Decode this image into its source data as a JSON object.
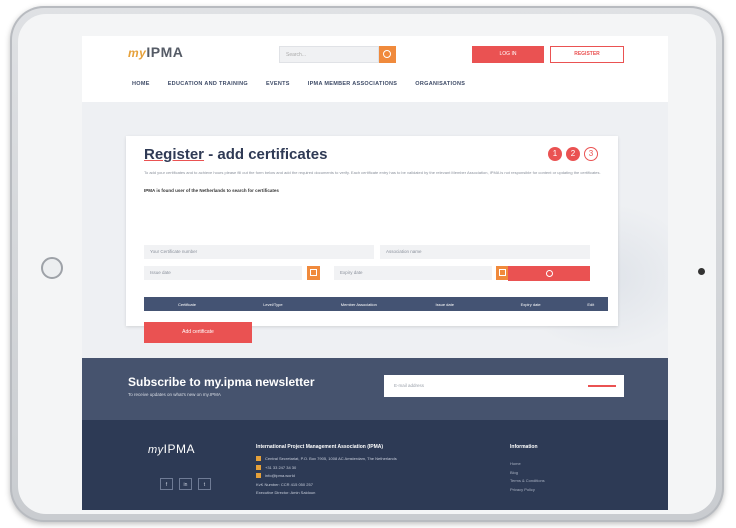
{
  "header": {
    "logo_prefix": "my",
    "logo_main": "IPMA",
    "search_placeholder": "Search...",
    "login_label": "LOG IN",
    "register_label": "REGISTER",
    "nav": [
      "HOME",
      "EDUCATION AND TRAINING",
      "EVENTS",
      "IPMA MEMBER ASSOCIATIONS",
      "ORGANISATIONS"
    ]
  },
  "card": {
    "title_part1": "Register",
    "title_part2": " - add certificates",
    "step_icons": [
      "1",
      "2",
      "3"
    ],
    "description": "To add your certificates and to achieve hours please fill out the form below and add the required documents to verify. Each certificate entry has to be validated by the relevant Member Association, IPMA is not responsible for content or updating the certificates.",
    "description_strong": "IPMA is found user of the Netherlands to search for certificates",
    "fields": {
      "cert_number": "Your Certificate number",
      "member_association": "Association name",
      "issue_date": "Issue date",
      "expiry_date": "Expiry date"
    },
    "table_headers": [
      "Certificate",
      "Level/Type",
      "Member Association",
      "Issue date",
      "Expiry date",
      "Edit"
    ],
    "add_button": "Add certificate"
  },
  "newsletter": {
    "title": "Subscribe to my.ipma newsletter",
    "subtitle": "To receive updates on what's new on my.IPMA",
    "email_placeholder": "E-mail address"
  },
  "footer": {
    "logo_prefix": "my",
    "logo_main": "IPMA",
    "social": [
      "f",
      "in",
      "t"
    ],
    "org_title": "International Project Management Association (IPMA)",
    "org_lines": [
      "Central Secretariat, P.O. Box 7905, 1008 AC Amsterdam, The Netherlands",
      "+31 33 247 34 30",
      "info@ipma.world",
      "KvK Number: CCR 415 050 257",
      "Executive Director: Amin Saidoun"
    ],
    "info_title": "Information",
    "info_items": [
      "Home",
      "Blog",
      "Terms & Conditions",
      "Privacy Policy"
    ]
  }
}
